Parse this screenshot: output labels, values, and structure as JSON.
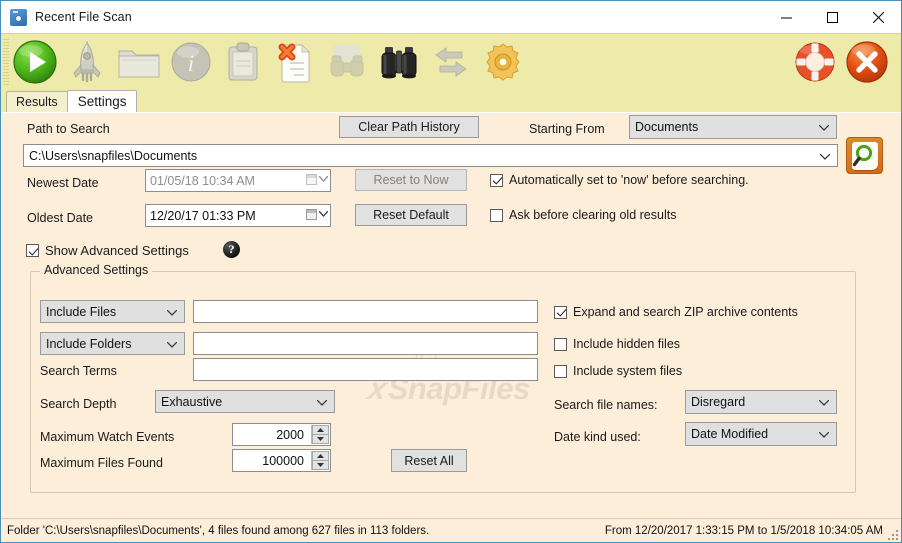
{
  "window": {
    "title": "Recent File Scan",
    "icon": "camera-app-icon",
    "minimize": "–",
    "maximize": "□",
    "close": "✕"
  },
  "toolbar": {
    "items": [
      {
        "name": "run-scan",
        "icon": "green-play-button-icon"
      },
      {
        "name": "quick-launch",
        "icon": "rocket-icon"
      },
      {
        "name": "open-folder",
        "icon": "folder-icon"
      },
      {
        "name": "about-info",
        "icon": "info-circle-icon"
      },
      {
        "name": "clipboard",
        "icon": "clipboard-icon"
      },
      {
        "name": "clear-results",
        "icon": "document-delete-icon"
      },
      {
        "name": "watch-disabled",
        "icon": "binoculars-disabled-icon"
      },
      {
        "name": "watch-folder",
        "icon": "binoculars-icon"
      },
      {
        "name": "refresh-swap",
        "icon": "swap-arrows-icon"
      },
      {
        "name": "settings-gear",
        "icon": "gear-icon"
      },
      {
        "name": "help-support",
        "icon": "lifebuoy-icon"
      },
      {
        "name": "exit",
        "icon": "red-x-circle-icon"
      }
    ]
  },
  "tabs": [
    {
      "label": "Results",
      "active": false
    },
    {
      "label": "Settings",
      "active": true
    }
  ],
  "watermark": "SnapFiles",
  "settings": {
    "path_label": "Path to Search",
    "clear_path_history_button": "Clear Path History",
    "starting_from_label": "Starting From",
    "starting_from_value": "Documents",
    "path_value": "C:\\Users\\snapfiles\\Documents",
    "search_button_icon": "magnifier-search-icon",
    "newest_date_label": "Newest Date",
    "newest_date_value": "01/05/18 10:34 AM",
    "reset_to_now_button": "Reset to Now",
    "auto_now_checkbox": "Automatically set to 'now' before searching.",
    "auto_now_checked": true,
    "oldest_date_label": "Oldest Date",
    "oldest_date_value": "12/20/17 01:33 PM",
    "reset_default_button": "Reset Default",
    "ask_clearing_checkbox": "Ask before clearing old results",
    "ask_clearing_checked": false,
    "show_advanced_checkbox": "Show Advanced Settings",
    "show_advanced_checked": true,
    "help_icon": "question-mark-icon"
  },
  "advanced": {
    "group_title": "Advanced Settings",
    "include_files_select": "Include Files",
    "include_files_value": "",
    "include_folders_select": "Include Folders",
    "include_folders_value": "",
    "search_terms_label": "Search Terms",
    "search_terms_value": "",
    "search_depth_label": "Search Depth",
    "search_depth_value": "Exhaustive",
    "max_watch_events_label": "Maximum Watch Events",
    "max_watch_events_value": "2000",
    "max_files_found_label": "Maximum Files Found",
    "max_files_found_value": "100000",
    "reset_all_button": "Reset All",
    "expand_zip_checkbox": "Expand and search ZIP archive contents",
    "expand_zip_checked": true,
    "include_hidden_checkbox": "Include hidden files",
    "include_hidden_checked": false,
    "include_system_checkbox": "Include system files",
    "include_system_checked": false,
    "search_file_names_label": "Search file names:",
    "search_file_names_value": "Disregard",
    "date_kind_label": "Date kind used:",
    "date_kind_value": "Date Modified"
  },
  "statusbar": {
    "left": "Folder 'C:\\Users\\snapfiles\\Documents', 4 files found among 627 files in 113 folders.",
    "right": "From 12/20/2017 1:33:15 PM to 1/5/2018 10:34:05 AM"
  },
  "colors": {
    "toolbar_bg": "#eeeaa9",
    "content_bg": "#fdeeda",
    "window_border": "#4a90b8",
    "accent_orange": "#d2691e",
    "accent_green": "#4da315"
  }
}
